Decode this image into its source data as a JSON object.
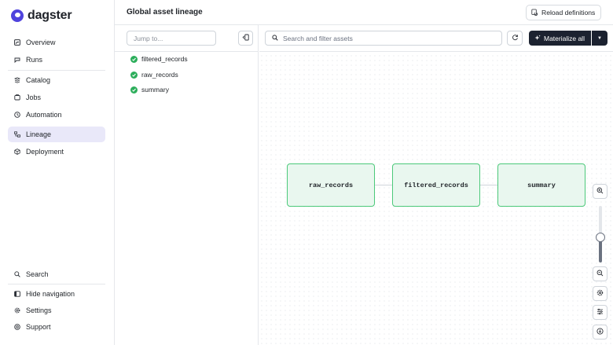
{
  "app": {
    "logo_text": "dagster"
  },
  "sidebar": {
    "items": [
      {
        "label": "Overview",
        "icon": "overview-icon"
      },
      {
        "label": "Runs",
        "icon": "runs-icon"
      },
      {
        "label": "Catalog",
        "icon": "catalog-icon"
      },
      {
        "label": "Jobs",
        "icon": "jobs-icon"
      },
      {
        "label": "Automation",
        "icon": "clock-icon"
      },
      {
        "label": "Lineage",
        "icon": "lineage-icon",
        "active": true
      },
      {
        "label": "Deployment",
        "icon": "cube-icon"
      }
    ],
    "bottom_items": [
      {
        "label": "Search",
        "icon": "search-icon"
      },
      {
        "label": "Hide navigation",
        "icon": "hide-nav-icon"
      },
      {
        "label": "Settings",
        "icon": "gear-icon"
      },
      {
        "label": "Support",
        "icon": "help-icon"
      }
    ]
  },
  "header": {
    "title": "Global asset lineage",
    "reload_label": "Reload definitions"
  },
  "left_panel": {
    "jump_placeholder": "Jump to...",
    "assets": [
      {
        "name": "filtered_records",
        "status": "success"
      },
      {
        "name": "raw_records",
        "status": "success"
      },
      {
        "name": "summary",
        "status": "success"
      }
    ]
  },
  "graph": {
    "search_placeholder": "Search and filter assets",
    "materialize_label": "Materialize all",
    "nodes": [
      {
        "label": "raw_records"
      },
      {
        "label": "filtered_records"
      },
      {
        "label": "summary"
      }
    ],
    "zoom_level": 0.45
  },
  "colors": {
    "accent": "#4f43dd",
    "active_nav_bg": "#e9e8f9",
    "success": "#2cae5b",
    "node_border": "#4cc97a",
    "node_fill": "#e9f7ef",
    "primary_button": "#1c2230"
  }
}
